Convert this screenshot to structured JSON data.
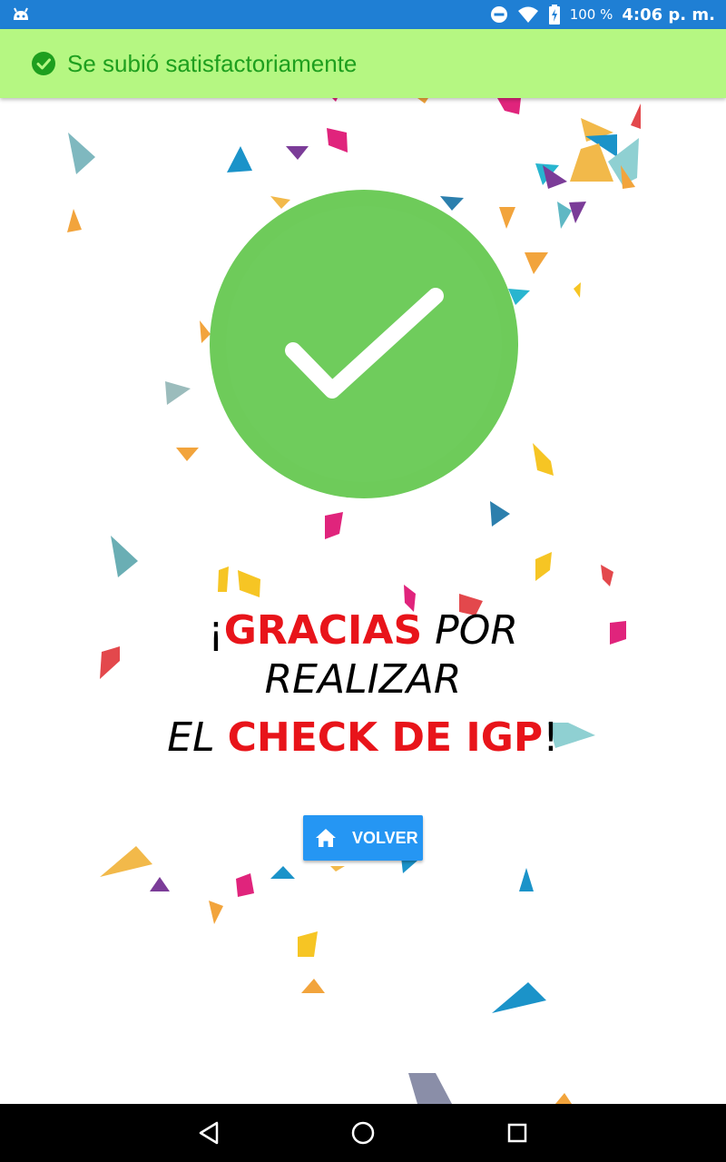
{
  "status_bar": {
    "battery_text": "100 %",
    "time": "4:06 p. m."
  },
  "toast": {
    "message": "Se subió satisfactoriamente",
    "icon": "check-circle-icon",
    "color": "#1e9f1e",
    "background": "#b5f782"
  },
  "main": {
    "success_icon": "check-circle-icon",
    "success_color": "#6ecb5a",
    "message": {
      "exclaim_open": "¡",
      "gracias": "GRACIAS",
      "por": " POR",
      "realizar": "REALIZAR",
      "el": "EL ",
      "check": "CHECK DE IGP",
      "exclaim_close": "!"
    },
    "highlight_color": "#e8141a"
  },
  "volver_button": {
    "label": "VOLVER",
    "icon": "home-icon",
    "color": "#2596f3"
  },
  "nav_bar": {
    "back": "back-icon",
    "home": "home-circle-icon",
    "recents": "recents-icon"
  }
}
